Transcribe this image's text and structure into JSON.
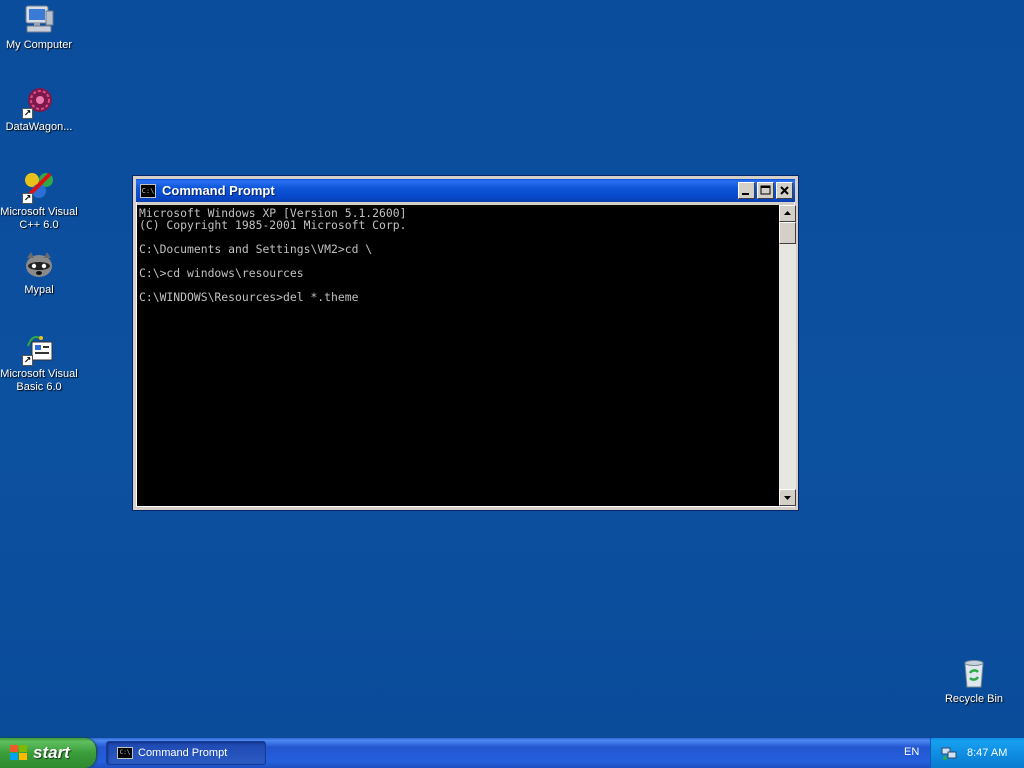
{
  "desktop": {
    "icons": [
      {
        "label": "My Computer",
        "icon": "my-computer-icon"
      },
      {
        "label": "DataWagon...",
        "icon": "datawagon-icon"
      },
      {
        "label": "Microsoft Visual\nC++ 6.0",
        "icon": "visual-cpp-icon"
      },
      {
        "label": "Mypal",
        "icon": "mypal-icon"
      },
      {
        "label": "Microsoft Visual\nBasic 6.0",
        "icon": "visual-basic-icon"
      },
      {
        "label": "Recycle Bin",
        "icon": "recycle-bin-icon"
      }
    ]
  },
  "window": {
    "title": "Command Prompt",
    "app_icon_text": "C:\\",
    "console_lines": [
      "Microsoft Windows XP [Version 5.1.2600]",
      "(C) Copyright 1985-2001 Microsoft Corp.",
      "",
      "C:\\Documents and Settings\\VM2>cd \\",
      "",
      "C:\\>cd windows\\resources",
      "",
      "C:\\WINDOWS\\Resources>del *.theme"
    ]
  },
  "taskbar": {
    "start_label": "start",
    "task_item_label": "Command Prompt",
    "language": "EN",
    "clock": "8:47 AM"
  },
  "colors": {
    "desktop": "#0b4f9e",
    "taskbar": "#245fdc",
    "start_button": "#3a9d3a",
    "console_bg": "#000000",
    "console_fg": "#c0c0c0"
  }
}
